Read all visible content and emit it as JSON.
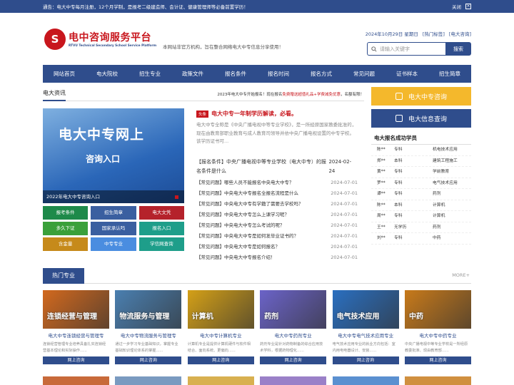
{
  "notice": {
    "text": "通告：电大中专每月注册，12个月学制，是报考二级建造师、会计证、健康管理师等必备前置学历！",
    "close": "关闭"
  },
  "header": {
    "logo_char": "S",
    "title": "电中咨询服务平台",
    "subtitle": "RTVU Technical Secondary School Service Platform",
    "slogan": "本网站非官方机构，旨在整合网络电大中专信息分享使用！",
    "date": "2024年10月29日 星期日",
    "sitemap": "[热门标签]",
    "consult": "[电大咨询]",
    "search_placeholder": "请输入关键字",
    "search_button": "搜索"
  },
  "nav": [
    "网站首页",
    "电大院校",
    "招生专业",
    "政策文件",
    "报名条件",
    "报名时间",
    "报名方式",
    "常见问题",
    "证书样本",
    "招生简章"
  ],
  "news_section": {
    "title": "电大资讯",
    "ticker_a": "2023年电大中专开始报名！现在报名",
    "ticker_b": "免费赠送超值礼品+学费减免优惠",
    "ticker_c": "，名额有限！"
  },
  "banner": {
    "line1": "电大中专网上",
    "line2": "咨询入口",
    "caption": "2022年电大中专咨询入口"
  },
  "quick_links": [
    {
      "label": "报考条件",
      "color": "g-green"
    },
    {
      "label": "招生简章",
      "color": "g-blue"
    },
    {
      "label": "电大文凭",
      "color": "g-red"
    },
    {
      "label": "多久下证",
      "color": "g-lime"
    },
    {
      "label": "国家承认吗",
      "color": "g-blue"
    },
    {
      "label": "报名入口",
      "color": "g-teal"
    },
    {
      "label": "含金量",
      "color": "g-gold"
    },
    {
      "label": "中专专业",
      "color": "g-sky"
    },
    {
      "label": "学信网查询",
      "color": "g-teal"
    }
  ],
  "headline": {
    "badge": "头条",
    "title": "电大中专一年制学历解读，必看。",
    "summary": "电大中专全称是《中央广播电视中等专业学校》，是一所经原国家教委批准的，现在由教育部职业教育与成人教育司领导并依中央广播电视设置的中专学校。该学历证书可..."
  },
  "news": [
    {
      "title": "【报名条件】中央广播电视中等专业学校（电大中专）的报名条件是什么",
      "date": "2024-02-24"
    },
    {
      "title": "【常见问题】哪些人员不能报名中央电大中专？",
      "date": "2024-07-01"
    },
    {
      "title": "【常见问题】中央电大中专报名全报名流程是什么",
      "date": "2024-07-01"
    },
    {
      "title": "【常见问题】中央电大中专有学籍了需要去学校吗？",
      "date": "2024-07-01"
    },
    {
      "title": "【常见问题】中央电大中专怎么上课学习呢？",
      "date": "2024-07-01"
    },
    {
      "title": "【常见问题】中央电大中专怎么考试的呢？",
      "date": "2024-07-01"
    },
    {
      "title": "【常见问题】中央电大中专是如何发毕业证书的？",
      "date": "2024-07-01"
    },
    {
      "title": "【常见问题】中央电大中专是如何报名？",
      "date": "2024-07-01"
    },
    {
      "title": "【常见问题】中央电大中专报名介绍！",
      "date": "2024-07-01"
    }
  ],
  "side": {
    "btn1": "电大中专咨询",
    "btn1_color": "#f4b82c",
    "btn2": "电大信息查询",
    "btn2_color": "#2f4d8c",
    "list_title": "电大报名成功学员",
    "students": [
      {
        "name": "陈**",
        "level": "专科",
        "major": "机电技术应用"
      },
      {
        "name": "郑**",
        "level": "本科",
        "major": "建筑工程施工"
      },
      {
        "name": "黄**",
        "level": "专科",
        "major": "学前教育"
      },
      {
        "name": "罗**",
        "level": "专科",
        "major": "电气技术应用"
      },
      {
        "name": "谭**",
        "level": "专科",
        "major": "药剂"
      },
      {
        "name": "陈**",
        "level": "本科",
        "major": "计算机"
      },
      {
        "name": "周**",
        "level": "专科",
        "major": "计算机"
      },
      {
        "name": "王**",
        "level": "无学历",
        "major": "药剂"
      },
      {
        "name": "刘**",
        "level": "专科",
        "major": "中药"
      }
    ]
  },
  "hot": {
    "title": "热门专业",
    "more": "MORE+"
  },
  "majors": [
    {
      "pic_label": "连锁经营与管理",
      "name": "电大中专连锁经营与管理专",
      "desc": "连锁经营管理专业培养具备扎实连锁经营基本理论和实际操作......",
      "btn": "网上咨询",
      "bg": "#d2691e"
    },
    {
      "pic_label": "物流服务与管理",
      "name": "电大中专物流服务与管理专",
      "desc": "通过一步学习专业基础知识，掌握专业基础知识理论体系的掌握......",
      "btn": "网上咨询",
      "bg": "#4a7fb0"
    },
    {
      "pic_label": "计算机",
      "name": "电大中专计算机专业",
      "desc": "计算机专业是提供计算机硬件与软件相结合、面向系统、更偏向......",
      "btn": "网上咨询",
      "bg": "#d4a017"
    },
    {
      "pic_label": "药剂",
      "name": "电大中专药剂专业",
      "desc": "药剂专业是针对药物制备的综合应用技术学科，根据药物理化......",
      "btn": "网上咨询",
      "bg": "#6b63c8"
    },
    {
      "pic_label": "电气技术应用",
      "name": "电大中专电气技术应用专业",
      "desc": "电气技术应用专业的就业方向包括：室内用电电器设计、安装......",
      "btn": "网上咨询",
      "bg": "#2a6fc0"
    },
    {
      "pic_label": "中药",
      "name": "电大中专中药专业",
      "desc": "中央广播电视中等专业学校是一所经原教委批准、现由教育部......",
      "btn": "网上咨询",
      "bg": "#c87a1a"
    }
  ]
}
